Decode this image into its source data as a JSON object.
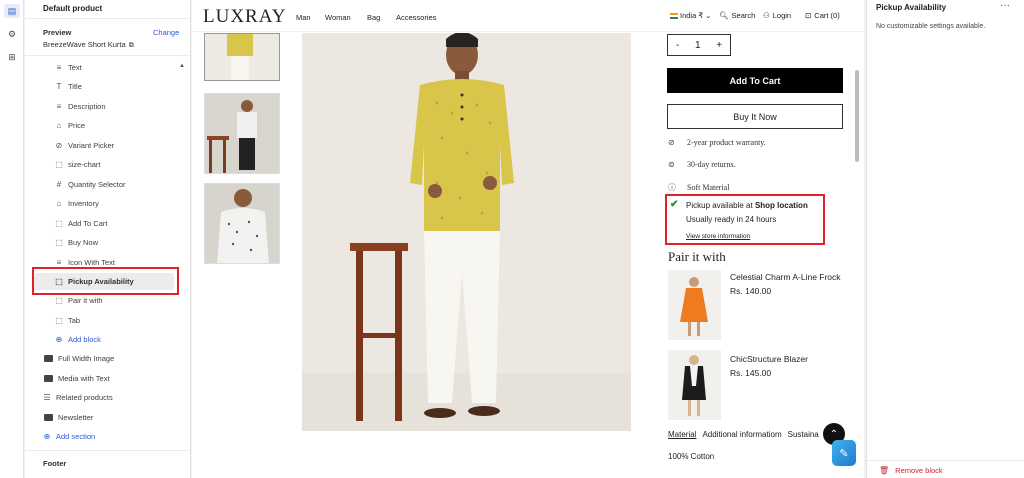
{
  "rail": {
    "icons": [
      "layout-icon",
      "gear-icon",
      "apps-icon"
    ]
  },
  "sidebar": {
    "title": "Default product",
    "preview_label": "Preview",
    "change_label": "Change",
    "product_name": "BreezeWave Short Kurta",
    "blocks": [
      {
        "label": "Text",
        "icon": "text-icon"
      },
      {
        "label": "Title",
        "icon": "title-icon"
      },
      {
        "label": "Description",
        "icon": "text-icon"
      },
      {
        "label": "Price",
        "icon": "tag-icon"
      },
      {
        "label": "Variant Picker",
        "icon": "variant-icon"
      },
      {
        "label": "size-chart",
        "icon": "block-icon"
      },
      {
        "label": "Quantity Selector",
        "icon": "hash-icon"
      },
      {
        "label": "Inventory",
        "icon": "inventory-icon"
      },
      {
        "label": "Add To Cart",
        "icon": "block-icon"
      },
      {
        "label": "Buy Now",
        "icon": "block-icon"
      },
      {
        "label": "Icon With Text",
        "icon": "text-icon"
      },
      {
        "label": "Pickup Availability",
        "icon": "block-icon"
      },
      {
        "label": "Pair it with",
        "icon": "block-icon"
      },
      {
        "label": "Tab",
        "icon": "block-icon"
      }
    ],
    "add_block": "Add block",
    "sections": [
      {
        "label": "Full Width Image"
      },
      {
        "label": "Media with Text"
      },
      {
        "label": "Related products"
      },
      {
        "label": "Newsletter"
      }
    ],
    "add_section": "Add section",
    "footer_label": "Footer"
  },
  "store": {
    "logo": "LUXRAY",
    "nav": [
      "Man",
      "Woman",
      "Bag",
      "Accessories"
    ],
    "region": "India ₹",
    "search": "Search",
    "login": "Login",
    "cart": "Cart (0)"
  },
  "product": {
    "quantity": "1",
    "qty_minus": "-",
    "qty_plus": "+",
    "add_to_cart": "Add To Cart",
    "buy_now": "Buy It Now",
    "features": [
      {
        "text": "2-year product warranty.",
        "icon": "shield-check-icon"
      },
      {
        "text": "30-day returns.",
        "icon": "return-icon"
      },
      {
        "text": "Soft Material",
        "icon": "info-icon"
      }
    ],
    "pickup": {
      "line1_prefix": "Pickup available at ",
      "line1_location": "Shop location",
      "line2": "Usually ready in 24 hours",
      "link": "View store information"
    },
    "pair_title": "Pair it with",
    "pair_items": [
      {
        "name": "Celestial Charm A-Line Frock",
        "price": "Rs. 140.00"
      },
      {
        "name": "ChicStructure Blazer",
        "price": "Rs. 145.00"
      }
    ],
    "tabs": [
      "Material",
      "Additional informatiom",
      "Sustaina"
    ],
    "tab_content": "100% Cotton"
  },
  "panel": {
    "title": "Pickup Availability",
    "more": "···",
    "empty_message": "No customizable settings available.",
    "remove_label": "Remove block"
  },
  "colors": {
    "accent": "#2b5bd7",
    "highlight": "#e0222b",
    "shirt": "#d8c54a",
    "danger": "#c7262e"
  }
}
